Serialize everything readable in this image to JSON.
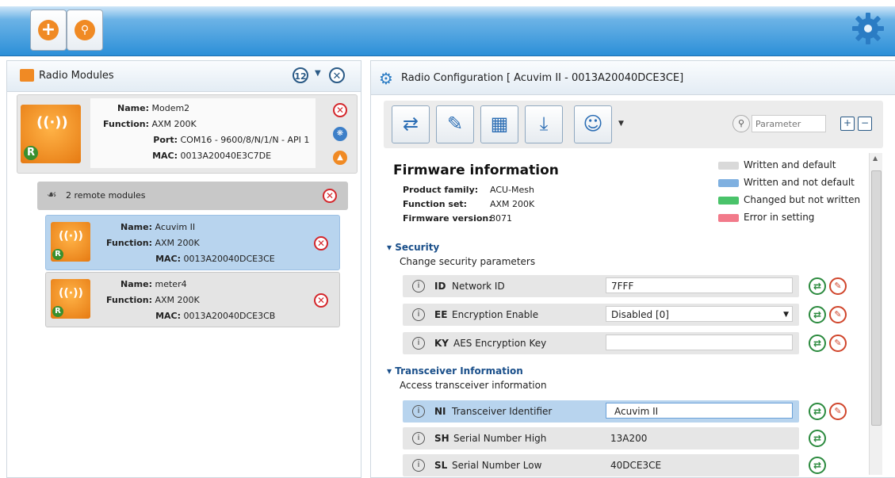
{
  "toolbar": {
    "add_icon": "plus-icon",
    "search_icon": "search-icon",
    "settings_icon": "gear-icon"
  },
  "left_panel": {
    "title": "Radio Modules",
    "sort_label": "12",
    "local_module": {
      "name_label": "Name:",
      "name": "Modem2",
      "function_label": "Function:",
      "function": "AXM 200K",
      "port_label": "Port:",
      "port": "COM16 - 9600/8/N/1/N - API 1",
      "mac_label": "MAC:",
      "mac": "0013A20040E3C7DE"
    },
    "remote_header": "2 remote modules",
    "remote_modules": [
      {
        "name_label": "Name:",
        "name": "Acuvim II",
        "function_label": "Function:",
        "function": "AXM 200K",
        "mac_label": "MAC:",
        "mac": "0013A20040DCE3CE",
        "selected": true
      },
      {
        "name_label": "Name:",
        "name": "meter4",
        "function_label": "Function:",
        "function": "AXM 200K",
        "mac_label": "MAC:",
        "mac": "0013A20040DCE3CB",
        "selected": false
      }
    ]
  },
  "right_panel": {
    "title": "Radio Configuration [ Acuvim II - 0013A20040DCE3CE]",
    "search_placeholder": "Parameter",
    "firmware": {
      "title": "Firmware information",
      "product_family_label": "Product family:",
      "product_family": "ACU-Mesh",
      "function_set_label": "Function set:",
      "function_set": "AXM 200K",
      "firmware_version_label": "Firmware version:",
      "firmware_version": "8071"
    },
    "legend": [
      {
        "label": "Written and default",
        "color": "#d9d9d9"
      },
      {
        "label": "Written and not default",
        "color": "#7fb0e0"
      },
      {
        "label": "Changed but not written",
        "color": "#4ac36a"
      },
      {
        "label": "Error in setting",
        "color": "#f27a8a"
      }
    ],
    "sections": [
      {
        "title": "Security",
        "description": "Change security parameters",
        "rows": [
          {
            "code": "ID",
            "label": "Network ID",
            "value": "7FFF",
            "kind": "input",
            "writable": true
          },
          {
            "code": "EE",
            "label": "Encryption Enable",
            "value": "Disabled [0]",
            "kind": "select",
            "writable": true
          },
          {
            "code": "KY",
            "label": "AES Encryption Key",
            "value": "",
            "kind": "input",
            "writable": true
          }
        ]
      },
      {
        "title": "Transceiver Information",
        "description": "Access transceiver information",
        "rows": [
          {
            "code": "NI",
            "label": "Transceiver Identifier",
            "value": "Acuvim II",
            "kind": "input",
            "writable": true,
            "selected": true
          },
          {
            "code": "SH",
            "label": "Serial Number High",
            "value": "13A200",
            "kind": "plain",
            "writable": false
          },
          {
            "code": "SL",
            "label": "Serial Number Low",
            "value": "40DCE3CE",
            "kind": "plain",
            "writable": false
          }
        ]
      }
    ]
  }
}
